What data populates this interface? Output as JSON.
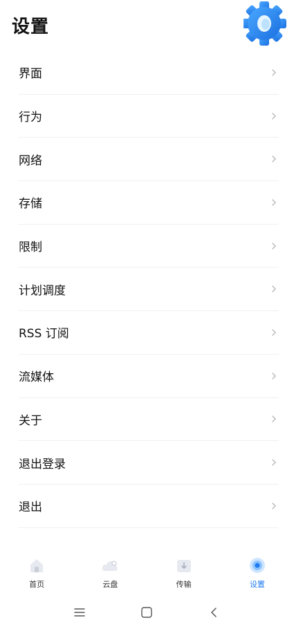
{
  "header": {
    "title": "设置",
    "decoration_icon": "gear-icon",
    "accent_color": "#2f8ff5"
  },
  "menu": {
    "items": [
      {
        "label": "界面"
      },
      {
        "label": "行为"
      },
      {
        "label": "网络"
      },
      {
        "label": "存储"
      },
      {
        "label": "限制"
      },
      {
        "label": "计划调度"
      },
      {
        "label": "RSS 订阅"
      },
      {
        "label": "流媒体"
      },
      {
        "label": "关于"
      },
      {
        "label": "退出登录"
      },
      {
        "label": "退出"
      }
    ],
    "trailing_icon": "chevron-right-icon"
  },
  "tabbar": {
    "active_color": "#1e7bf0",
    "tabs": [
      {
        "label": "首页",
        "icon": "home-icon",
        "active": false
      },
      {
        "label": "云盘",
        "icon": "cloud-icon",
        "active": false
      },
      {
        "label": "传输",
        "icon": "transfer-icon",
        "active": false
      },
      {
        "label": "设置",
        "icon": "settings-icon",
        "active": true
      }
    ]
  },
  "system_nav": {
    "buttons": [
      "menu-icon",
      "home-square-icon",
      "back-icon"
    ]
  }
}
